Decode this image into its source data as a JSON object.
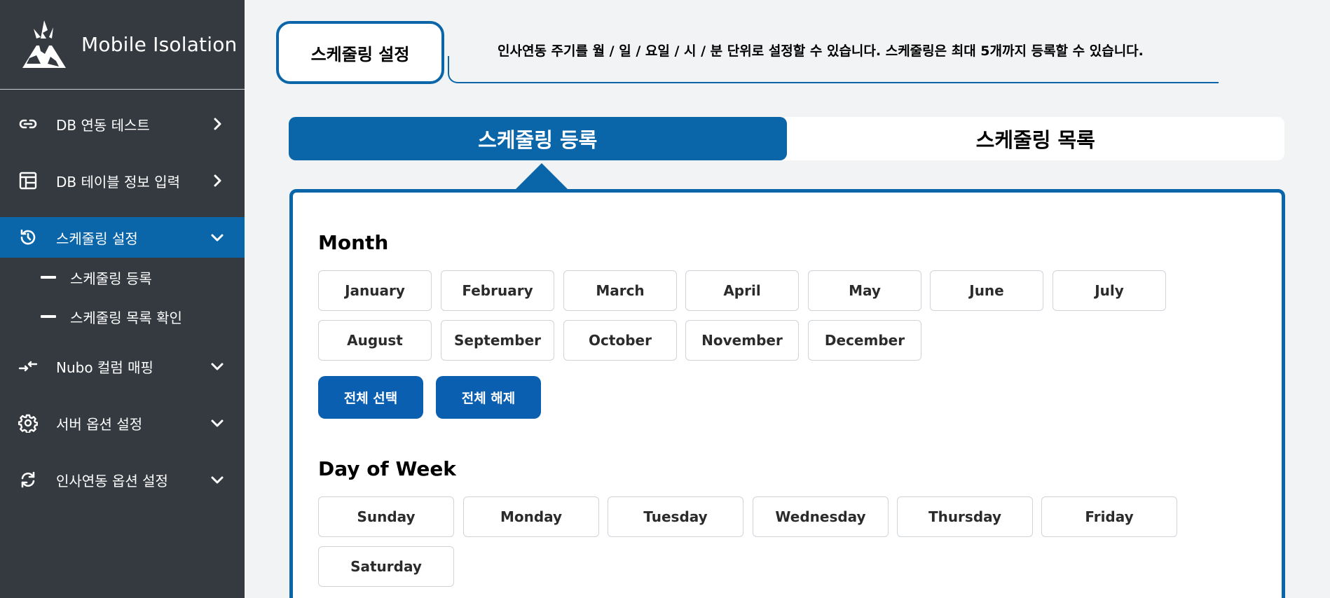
{
  "sidebar": {
    "brand": "Mobile Isolation",
    "items": [
      {
        "label": "DB 연동 테스트",
        "icon": "link-icon",
        "chevron": "right"
      },
      {
        "label": "DB 테이블 정보 입력",
        "icon": "table-icon",
        "chevron": "right"
      },
      {
        "label": "스케줄링 설정",
        "icon": "clock-refresh-icon",
        "chevron": "down",
        "active": true,
        "children": [
          {
            "label": "스케줄링 등록"
          },
          {
            "label": "스케줄링 목록 확인"
          }
        ]
      },
      {
        "label": "Nubo 컬럼 매핑",
        "icon": "mapping-arrows-icon",
        "chevron": "down"
      },
      {
        "label": "서버 옵션 설정",
        "icon": "gear-icon",
        "chevron": "down"
      },
      {
        "label": "인사연동 옵션 설정",
        "icon": "sync-icon",
        "chevron": "down"
      }
    ]
  },
  "header": {
    "title": "스케줄링 설정",
    "description": "인사연동 주기를 월 / 일 / 요일 / 시 / 분 단위로 설정할 수 있습니다. 스케줄링은 최대 5개까지 등록할 수 있습니다."
  },
  "tabs": [
    {
      "label": "스케줄링 등록",
      "active": true
    },
    {
      "label": "스케줄링 목록",
      "active": false
    }
  ],
  "month_section": {
    "title": "Month",
    "months": [
      "January",
      "February",
      "March",
      "April",
      "May",
      "June",
      "July",
      "August",
      "September",
      "October",
      "November",
      "December"
    ],
    "select_all": "전체 선택",
    "deselect_all": "전체 해제"
  },
  "week_section": {
    "title": "Day of Week",
    "days": [
      "Sunday",
      "Monday",
      "Tuesday",
      "Wednesday",
      "Thursday",
      "Friday",
      "Saturday"
    ]
  },
  "colors": {
    "sidebar_bg": "#343a40",
    "accent": "#0a66a8",
    "button_blue": "#0a5fb0",
    "page_bg": "#f1f3f5"
  }
}
